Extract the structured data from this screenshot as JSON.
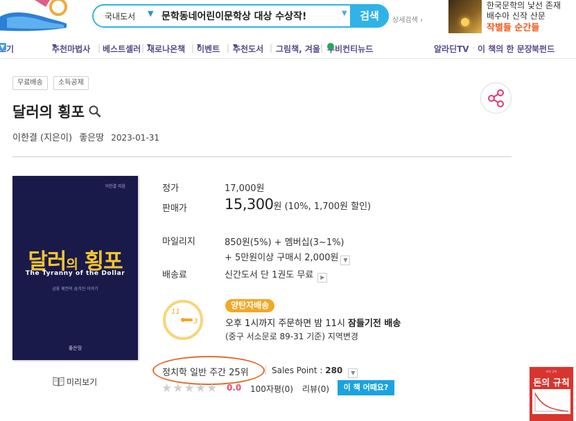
{
  "header": {
    "search": {
      "category": "국내도서",
      "query": "문학동네어린이문학상 대상 수상작!",
      "button_label": "검색",
      "advanced_label": "상세검색"
    },
    "ad": {
      "line1": "한국문학의 낯선 존재",
      "line2": "배수아 신작 산문",
      "line3": "작별들 순간들"
    }
  },
  "nav": {
    "cut_label": "보기",
    "items": [
      "추천마법사",
      "베스트셀러",
      "새로나온책",
      "이벤트",
      "추천도서",
      "그림책, 겨울",
      "투비컨티뉴드"
    ],
    "right_items": [
      "알라딘TV",
      "이 책의 한 문장",
      "북펀드"
    ]
  },
  "tags": [
    "무료배송",
    "소득공제"
  ],
  "book": {
    "title": "달러의 횡포",
    "author": "이한결 (지은이)",
    "publisher": "좋은땅",
    "date": "2023-01-31",
    "cover": {
      "author_small": "이한결 지음",
      "title_main": "달러",
      "title_particle": "의",
      "title_second": "횡포",
      "subtitle": "The Tyranny of the Dollar",
      "tagline": "금융 패권의 숨겨진 이야기",
      "publisher": "좋은땅"
    },
    "preview_label": "미리보기"
  },
  "pricing": {
    "list_price_label": "정가",
    "list_price": "17,000원",
    "sale_label": "판매가",
    "sale_price": "15,300",
    "sale_unit": "원",
    "discount": "(10%, 1,700원 할인)",
    "mileage_label": "마일리지",
    "mileage_line1": "850원(5%) + 멤버십(3~1%)",
    "mileage_line2": "+ 5만원이상 구매시 2,000원",
    "shipping_label": "배송료",
    "shipping_value": "신간도서 단 1권도 무료"
  },
  "delivery": {
    "badge": "양탄자배송",
    "clock_hour_11": "11",
    "clock_hour_3": "3",
    "line1_prefix": "오후 1시까지 주문하면 밤 11시 ",
    "line1_bold": "잠들기전 배송",
    "line2_prefix": "(중구 서소문로 89-31 기준) ",
    "line2_suffix": "지역변경"
  },
  "rank": {
    "text": "정치학 일반 주간 25위",
    "sales_point_label": "Sales Point : ",
    "sales_point_value": "280"
  },
  "rating": {
    "score": "0.0",
    "count_100": "100자평(0)",
    "review": "리뷰(0)",
    "button": "이 책 어때요?"
  },
  "side_book": {
    "top_text": "부의 규칙",
    "title": "돈의 규칙"
  },
  "colors": {
    "accent_blue": "#2fb3e6",
    "nav_purple": "#5b4a8a",
    "nav_pink": "#e52a6f",
    "rank_oval": "#e36a2f",
    "badge_orange": "#f5a623",
    "cover_bg": "#1a1a4a",
    "cover_title": "#f2c530"
  }
}
